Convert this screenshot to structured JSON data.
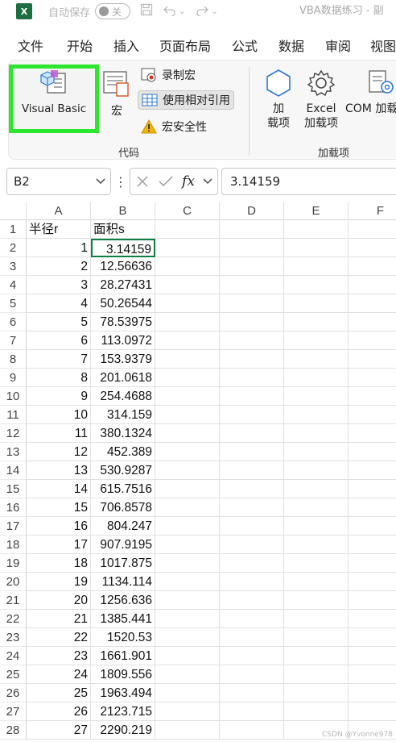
{
  "titlebar": {
    "autosave_label": "自动保存",
    "autosave_state": "关",
    "doc_title": "VBA数据练习 - 副"
  },
  "menu": [
    "文件",
    "开始",
    "插入",
    "页面布局",
    "公式",
    "数据",
    "审阅",
    "视图"
  ],
  "ribbon": {
    "visual_basic": "Visual Basic",
    "macros": "宏",
    "record_macro": "录制宏",
    "relative_ref": "使用相对引用",
    "macro_security": "宏安全性",
    "code_group": "代码",
    "addins_line1": "加",
    "addins_line2": "载项",
    "excel_addins_line1": "Excel",
    "excel_addins_line2": "加载项",
    "com_addins": "COM 加载",
    "addins_group": "加载项"
  },
  "formula_bar": {
    "name_box": "B2",
    "fx": "fx",
    "value": "3.14159"
  },
  "columns": [
    "A",
    "B",
    "C",
    "D",
    "E",
    "F"
  ],
  "sheet": {
    "header": {
      "a": "半径r",
      "b": "面积s"
    },
    "rows": [
      {
        "n": "2",
        "a": "1",
        "b": "3.14159"
      },
      {
        "n": "3",
        "a": "2",
        "b": "12.56636"
      },
      {
        "n": "4",
        "a": "3",
        "b": "28.27431"
      },
      {
        "n": "5",
        "a": "4",
        "b": "50.26544"
      },
      {
        "n": "6",
        "a": "5",
        "b": "78.53975"
      },
      {
        "n": "7",
        "a": "6",
        "b": "113.0972"
      },
      {
        "n": "8",
        "a": "7",
        "b": "153.9379"
      },
      {
        "n": "9",
        "a": "8",
        "b": "201.0618"
      },
      {
        "n": "10",
        "a": "9",
        "b": "254.4688"
      },
      {
        "n": "11",
        "a": "10",
        "b": "314.159"
      },
      {
        "n": "12",
        "a": "11",
        "b": "380.1324"
      },
      {
        "n": "13",
        "a": "12",
        "b": "452.389"
      },
      {
        "n": "14",
        "a": "13",
        "b": "530.9287"
      },
      {
        "n": "15",
        "a": "14",
        "b": "615.7516"
      },
      {
        "n": "16",
        "a": "15",
        "b": "706.8578"
      },
      {
        "n": "17",
        "a": "16",
        "b": "804.247"
      },
      {
        "n": "18",
        "a": "17",
        "b": "907.9195"
      },
      {
        "n": "19",
        "a": "18",
        "b": "1017.875"
      },
      {
        "n": "20",
        "a": "19",
        "b": "1134.114"
      },
      {
        "n": "21",
        "a": "20",
        "b": "1256.636"
      },
      {
        "n": "22",
        "a": "21",
        "b": "1385.441"
      },
      {
        "n": "23",
        "a": "22",
        "b": "1520.53"
      },
      {
        "n": "24",
        "a": "23",
        "b": "1661.901"
      },
      {
        "n": "25",
        "a": "24",
        "b": "1809.556"
      },
      {
        "n": "26",
        "a": "25",
        "b": "1963.494"
      },
      {
        "n": "27",
        "a": "26",
        "b": "2123.715"
      },
      {
        "n": "28",
        "a": "27",
        "b": "2290.219"
      }
    ]
  },
  "watermark": "CSDN @Yvonne978",
  "colors": {
    "excel_green": "#1d6f42",
    "highlight_green": "#2ee62e",
    "selection": "#107c41"
  }
}
